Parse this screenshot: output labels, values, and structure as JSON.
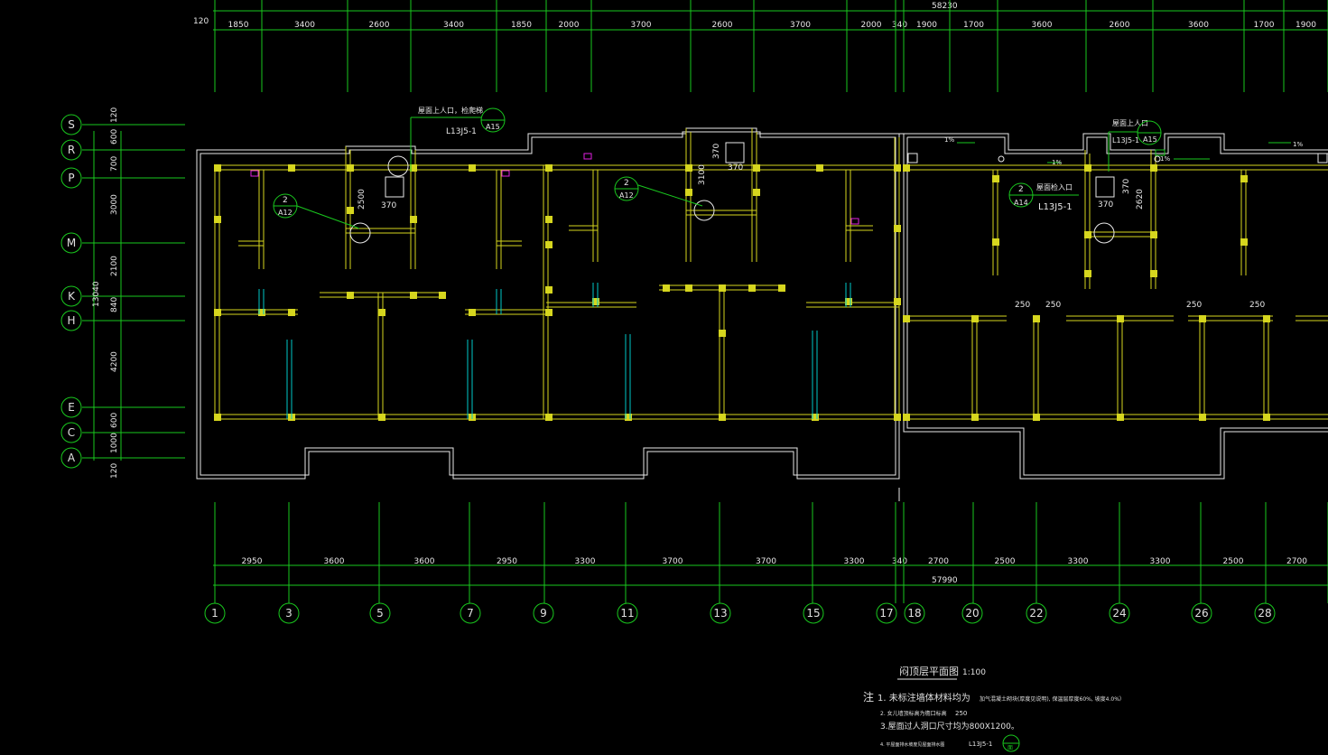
{
  "drawing": {
    "top_total": "58230",
    "top_offset": "120",
    "top_dims": [
      "1850",
      "3400",
      "2600",
      "3400",
      "1850",
      "2000",
      "3700",
      "2600",
      "3700",
      "2000",
      "340",
      "1900",
      "1700",
      "3600",
      "2600",
      "3600",
      "1700",
      "1900"
    ],
    "bottom_total": "57990",
    "bottom_dims": [
      "2950",
      "3600",
      "3600",
      "2950",
      "3300",
      "3700",
      "3700",
      "3300",
      "340",
      "2700",
      "2500",
      "3300",
      "3300",
      "2500",
      "2700"
    ],
    "column_axes": [
      "1",
      "3",
      "5",
      "7",
      "9",
      "11",
      "13",
      "15",
      "17",
      "18",
      "20",
      "22",
      "24",
      "26",
      "28"
    ],
    "row_axes": [
      "S",
      "R",
      "P",
      "M",
      "K",
      "H",
      "E",
      "C",
      "A"
    ],
    "left_dims": [
      "120",
      "600",
      "700",
      "3000",
      "2100",
      "840",
      "4200",
      "600",
      "1000",
      "120"
    ],
    "left_total": "13040",
    "annotations": {
      "roof_hatch_1": "屋面上人口，检爬梯",
      "roof_hatch_2": "屋面上人口",
      "roof_hatch_3": "屋面检入口",
      "detail_ref_1": "L13J5-1",
      "detail_ref_2": "L13J5-1",
      "detail_ref_3": "L13J5-1",
      "bubble_a15": "A15",
      "bubble_a15b": "A15",
      "bubble_a12": "A12",
      "bubble_a12b": "A12",
      "bubble_a14": "A14",
      "bubble_num": "2",
      "dim_370": "370",
      "dim_2500": "2500",
      "dim_3100": "3100",
      "dim_2620": "2620",
      "dim_250": "250",
      "slope_1pct": "1%"
    }
  },
  "notes": {
    "title": "闷顶层平面图",
    "scale": "1:100",
    "note_prefix": "注",
    "note1": "1. 未标注墙体材料均为",
    "note1b": "加气混凝土砌块(厚度见说明), 保温层厚度60%, 坡度4.0%）",
    "note2": "2. 女儿墙顶标高为檐口标高",
    "note2_val": "250",
    "note3": "3.屋面过人洞口尺寸均为800X1200。",
    "note4": "4. 平屋面排水坡度见屋面排水图",
    "note4_ref": "L13J5-1",
    "note4_bubble": "面"
  },
  "colors": {
    "grid": "#19c81e",
    "wall": "#d6d61e",
    "outline": "#e8e8e8",
    "cyan": "#00c8c8",
    "magenta": "#e020e0"
  }
}
